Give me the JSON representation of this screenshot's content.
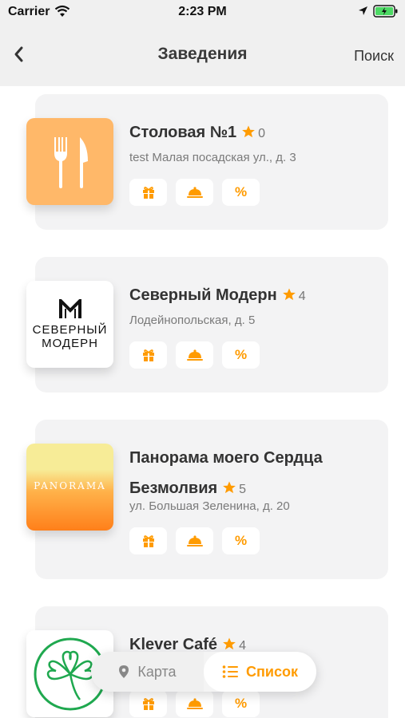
{
  "status_bar": {
    "carrier": "Carrier",
    "time": "2:23 PM"
  },
  "nav": {
    "title": "Заведения",
    "search_label": "Поиск"
  },
  "places": [
    {
      "name": "Столовая №1",
      "rating": "0",
      "address": "test Малая посадская ул.,  д. 3",
      "logo": "fork-knife-icon"
    },
    {
      "name": "Северный Модерн",
      "rating": "4",
      "address": "Лодейнопольская, д. 5",
      "logo_text": [
        "СЕВЕРНЫЙ",
        "МОДЕРН"
      ]
    },
    {
      "name_line1": "Панорама моего Сердца",
      "name_line2": "Безмолвия",
      "rating": "5",
      "address": "ул. Большая Зеленина, д. 20",
      "logo_text": "PANORAMA"
    },
    {
      "name": "Klever Café",
      "rating": "4",
      "logo": "clover-icon"
    }
  ],
  "badge_labels": {
    "discount": "%"
  },
  "view_switch": {
    "map_label": "Карта",
    "list_label": "Список",
    "active": "list"
  },
  "colors": {
    "accent": "#ff9b00",
    "card_bg": "#f3f3f4",
    "nav_bg": "#f0f0f0"
  }
}
